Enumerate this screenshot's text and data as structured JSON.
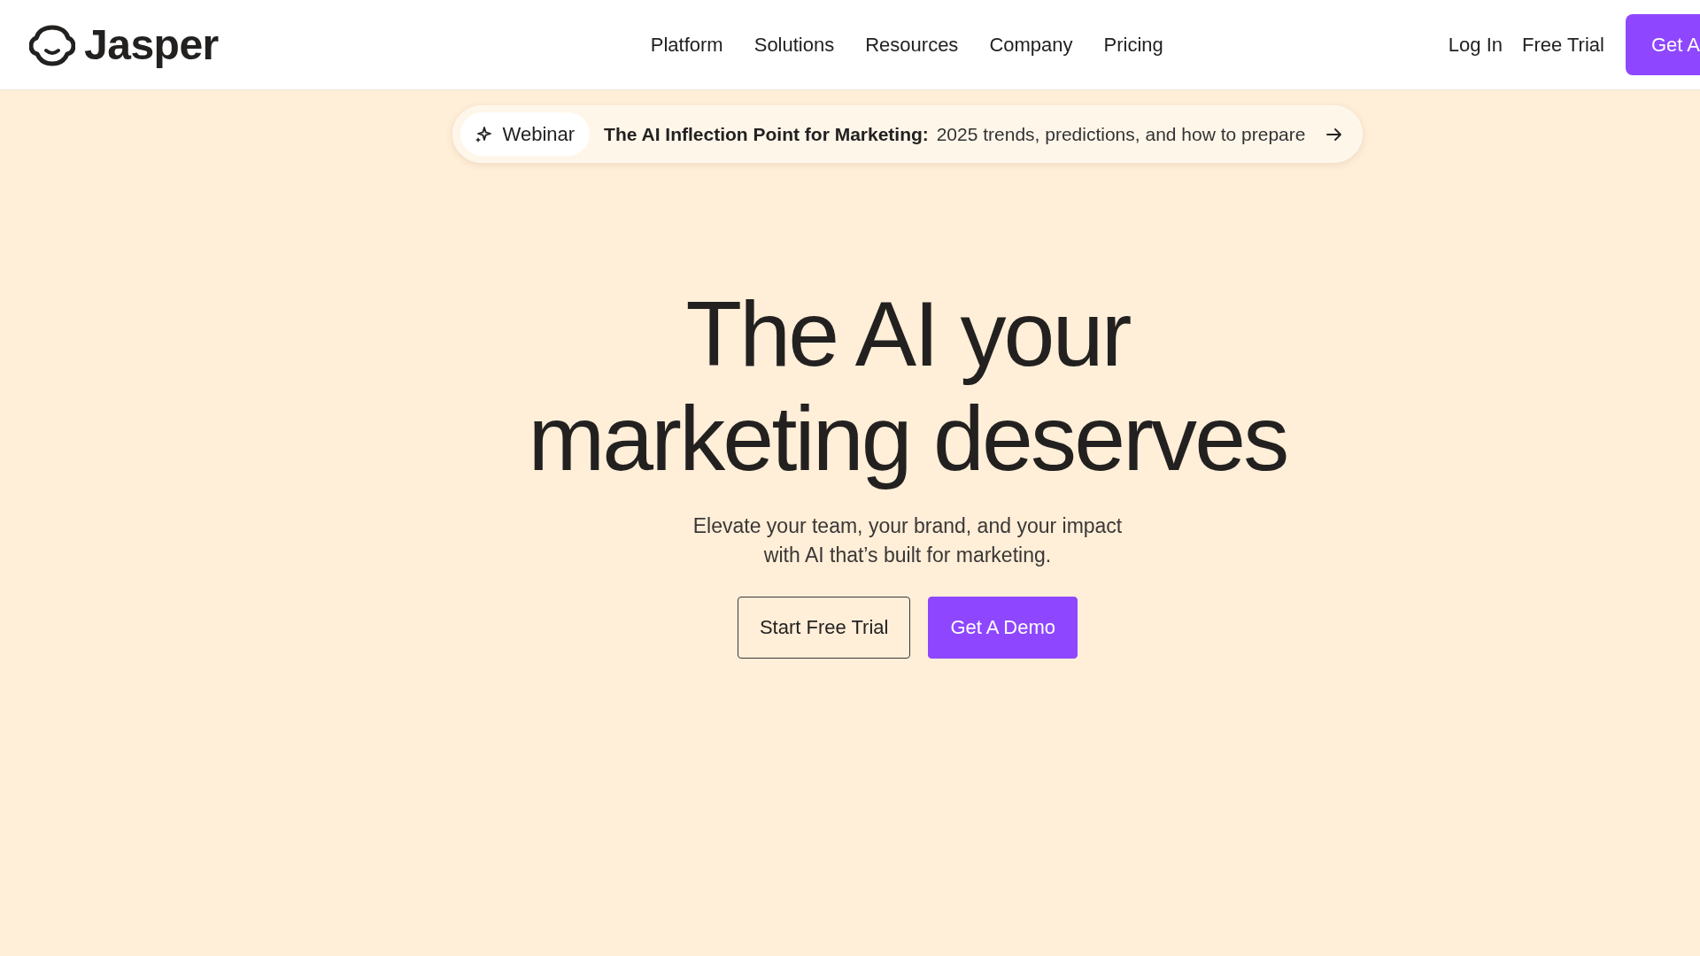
{
  "header": {
    "logo": {
      "wordmark": "Jasper"
    },
    "nav": [
      {
        "label": "Platform"
      },
      {
        "label": "Solutions"
      },
      {
        "label": "Resources"
      },
      {
        "label": "Company"
      },
      {
        "label": "Pricing"
      }
    ],
    "actions": [
      {
        "kind": "link",
        "label": "Log In"
      },
      {
        "kind": "link",
        "label": "Free Trial"
      },
      {
        "kind": "button",
        "label": "Get A"
      }
    ]
  },
  "announcement": {
    "tag": "Webinar",
    "text": "**The AI Inflection Point for Marketing:** 2025 trends, predictions, and how to prepare"
  },
  "hero": {
    "heading_lines": [
      "The AI your",
      "marketing deserves"
    ],
    "subheading_lines": [
      "Elevate your team, your brand, and your impact",
      "with AI that’s built for marketing."
    ],
    "buttons": [
      {
        "kind": "outline",
        "label": "Start Free Trial"
      },
      {
        "kind": "primary",
        "label": "Get A Demo"
      }
    ]
  }
}
